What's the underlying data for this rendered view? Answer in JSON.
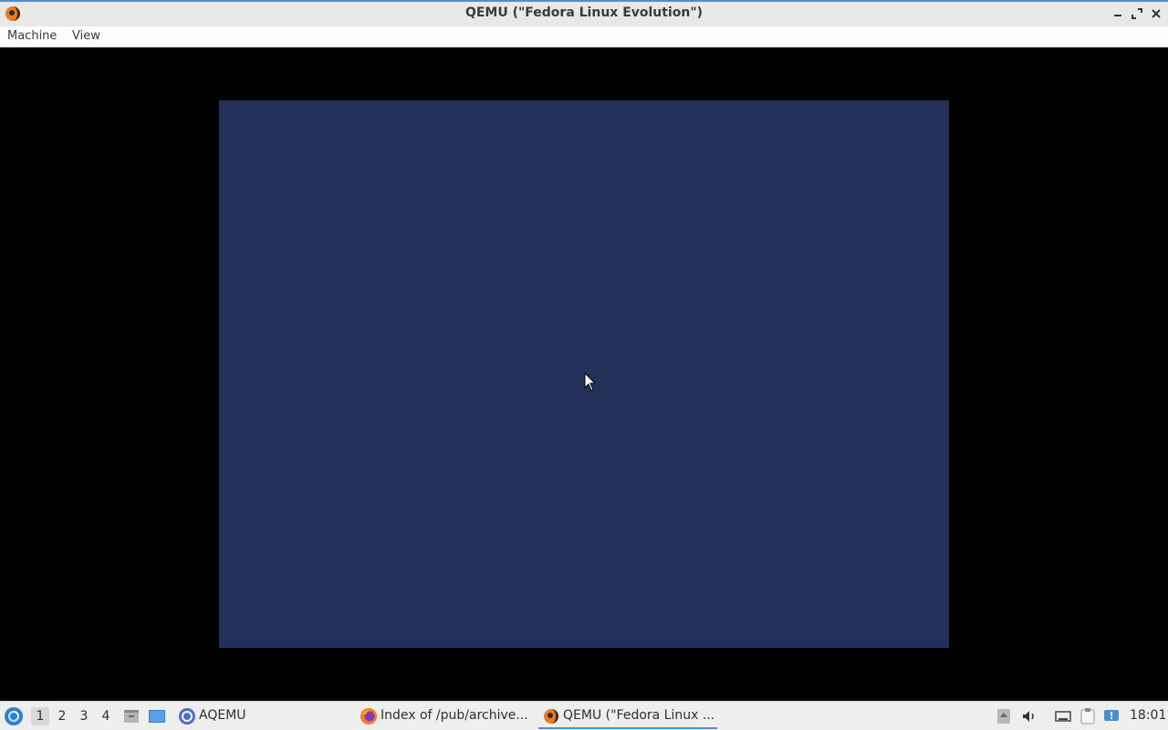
{
  "window": {
    "title": "QEMU (\"Fedora Linux Evolution\")",
    "menu": [
      "Machine",
      "View"
    ]
  },
  "colors": {
    "guest_screen": "#22305a",
    "accent": "#4a90d9"
  },
  "taskbar": {
    "workspaces": [
      "1",
      "2",
      "3",
      "4"
    ],
    "active_workspace": "1",
    "launcher_label": "AQEMU",
    "tasks": [
      {
        "label": "Index of /pub/archive...",
        "icon": "firefox-icon"
      },
      {
        "label": "QEMU (\"Fedora Linux ...",
        "icon": "qemu-icon"
      }
    ],
    "clock": "18:01"
  }
}
